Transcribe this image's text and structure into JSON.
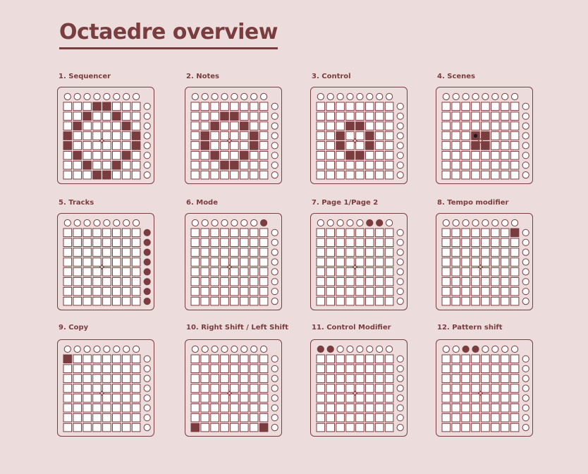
{
  "page": {
    "title": "Octaedre overview",
    "colors": {
      "background": "#ecdcdc",
      "accent": "#7a3d3f",
      "pad_off": "#ffffff"
    }
  },
  "panels": [
    {
      "label": "1. Sequencer",
      "top": [],
      "side": [],
      "grid": [
        [
          0,
          3
        ],
        [
          0,
          4
        ],
        [
          1,
          2
        ],
        [
          1,
          5
        ],
        [
          2,
          1
        ],
        [
          2,
          6
        ],
        [
          3,
          0
        ],
        [
          3,
          7
        ],
        [
          4,
          0
        ],
        [
          4,
          7
        ],
        [
          5,
          1
        ],
        [
          5,
          6
        ],
        [
          6,
          2
        ],
        [
          6,
          5
        ],
        [
          7,
          3
        ],
        [
          7,
          4
        ]
      ]
    },
    {
      "label": "2. Notes",
      "top": [],
      "side": [],
      "grid": [
        [
          1,
          3
        ],
        [
          1,
          4
        ],
        [
          2,
          2
        ],
        [
          2,
          5
        ],
        [
          3,
          1
        ],
        [
          3,
          6
        ],
        [
          4,
          1
        ],
        [
          4,
          6
        ],
        [
          5,
          2
        ],
        [
          5,
          5
        ],
        [
          6,
          3
        ],
        [
          6,
          4
        ]
      ]
    },
    {
      "label": "3. Control",
      "top": [],
      "side": [],
      "grid": [
        [
          2,
          3
        ],
        [
          2,
          4
        ],
        [
          3,
          2
        ],
        [
          3,
          5
        ],
        [
          4,
          2
        ],
        [
          4,
          5
        ],
        [
          5,
          3
        ],
        [
          5,
          4
        ]
      ]
    },
    {
      "label": "4. Scenes",
      "top": [],
      "side": [],
      "grid": [
        [
          3,
          3
        ],
        [
          3,
          4
        ],
        [
          4,
          3
        ],
        [
          4,
          4
        ]
      ],
      "marker": [
        3,
        3
      ]
    },
    {
      "label": "5. Tracks",
      "top": [],
      "side": [
        0,
        1,
        2,
        3,
        4,
        5,
        6,
        7
      ],
      "grid": []
    },
    {
      "label": "6. Mode",
      "top": [
        7
      ],
      "side": [],
      "grid": []
    },
    {
      "label": "7. Page 1/Page 2",
      "top": [
        5,
        6
      ],
      "side": [],
      "grid": []
    },
    {
      "label": "8. Tempo modifier",
      "top": [],
      "side": [],
      "grid": [
        [
          0,
          7
        ]
      ]
    },
    {
      "label": "9. Copy",
      "top": [],
      "side": [],
      "grid": [
        [
          0,
          0
        ]
      ]
    },
    {
      "label": "10. Right Shift / Left Shift",
      "top": [],
      "side": [],
      "grid": [
        [
          7,
          0
        ],
        [
          7,
          7
        ]
      ]
    },
    {
      "label": "11. Control Modifier",
      "top": [
        0,
        1
      ],
      "side": [],
      "grid": []
    },
    {
      "label": "12. Pattern shift",
      "top": [
        2,
        3
      ],
      "side": [],
      "grid": []
    }
  ]
}
